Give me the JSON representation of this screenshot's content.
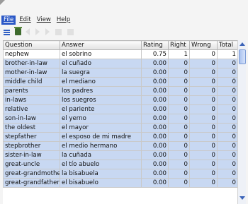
{
  "menu": {
    "items": [
      {
        "label": "File",
        "active": true
      },
      {
        "label": "Edit",
        "active": false
      },
      {
        "label": "View",
        "active": false
      },
      {
        "label": "Help",
        "active": false
      }
    ]
  },
  "toolbar": {
    "icons": [
      "list-icon",
      "trash-icon",
      "back-icon",
      "play-icon",
      "forward-icon",
      "stop-icon",
      "grid-icon"
    ]
  },
  "table": {
    "columns": [
      "Question",
      "Answer",
      "Rating",
      "Right",
      "Wrong",
      "Total"
    ],
    "rows": [
      [
        "nephew",
        "el sobrino",
        "0.75",
        "1",
        "0",
        "1"
      ],
      [
        "brother-in-law",
        "el cuñado",
        "0.00",
        "0",
        "0",
        "0"
      ],
      [
        "mother-in-law",
        "la suegra",
        "0.00",
        "0",
        "0",
        "0"
      ],
      [
        "middle child",
        "el mediano",
        "0.00",
        "0",
        "0",
        "0"
      ],
      [
        "parents",
        "los padres",
        "0.00",
        "0",
        "0",
        "0"
      ],
      [
        "in-laws",
        "los suegros",
        "0.00",
        "0",
        "0",
        "0"
      ],
      [
        "relative",
        "el pariente",
        "0.00",
        "0",
        "0",
        "0"
      ],
      [
        "son-in-law",
        "el yerno",
        "0.00",
        "0",
        "0",
        "0"
      ],
      [
        "the oldest",
        "el mayor",
        "0.00",
        "0",
        "0",
        "0"
      ],
      [
        "stepfather",
        "el esposo de mi madre",
        "0.00",
        "0",
        "0",
        "0"
      ],
      [
        "stepbrother",
        "el medio hermano",
        "0.00",
        "0",
        "0",
        "0"
      ],
      [
        "sister-in-law",
        "la cuñada",
        "0.00",
        "0",
        "0",
        "0"
      ],
      [
        "great-uncle",
        "el tío abuelo",
        "0.00",
        "0",
        "0",
        "0"
      ],
      [
        "great-grandmother",
        "la bisabuela",
        "0.00",
        "0",
        "0",
        "0"
      ],
      [
        "great-grandfather",
        "el bisabuelo",
        "0.00",
        "0",
        "0",
        "0"
      ]
    ]
  },
  "colors": {
    "selection": "#c8d8f2",
    "menu_active": "#2c59c7"
  }
}
